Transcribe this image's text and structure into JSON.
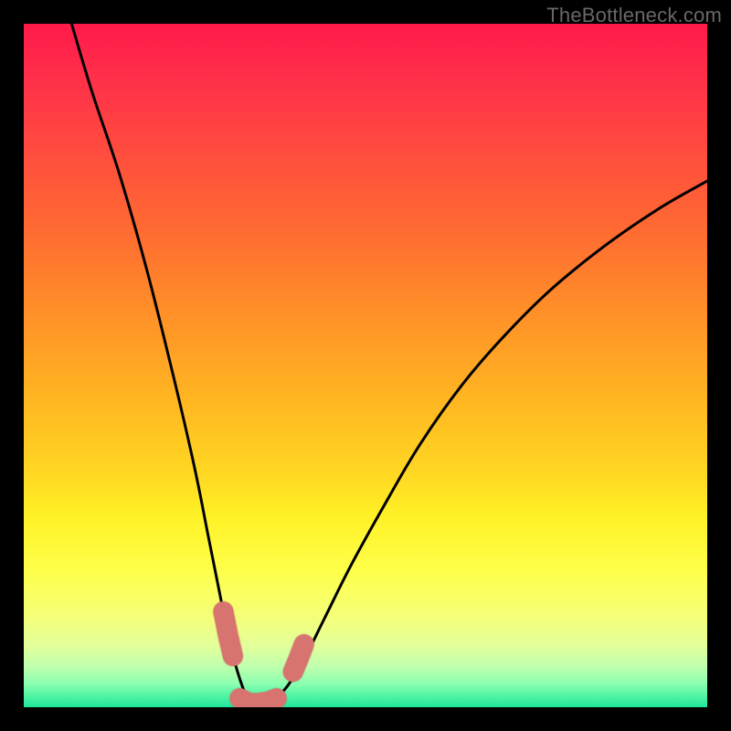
{
  "watermark": "TheBottleneck.com",
  "colors": {
    "frame": "#000000",
    "watermark": "#686868",
    "curve": "#000000",
    "markers_fill": "#d7746f",
    "markers_stroke": "#c8605b",
    "gradient_stops": [
      {
        "offset": 0.0,
        "color": "#ff1a4a"
      },
      {
        "offset": 0.08,
        "color": "#ff2f4a"
      },
      {
        "offset": 0.18,
        "color": "#ff4a3f"
      },
      {
        "offset": 0.3,
        "color": "#ff6a32"
      },
      {
        "offset": 0.42,
        "color": "#ff8f28"
      },
      {
        "offset": 0.55,
        "color": "#ffb621"
      },
      {
        "offset": 0.66,
        "color": "#ffd823"
      },
      {
        "offset": 0.72,
        "color": "#fff126"
      },
      {
        "offset": 0.8,
        "color": "#feff4a"
      },
      {
        "offset": 0.87,
        "color": "#f4ff7a"
      },
      {
        "offset": 0.91,
        "color": "#e2ff9a"
      },
      {
        "offset": 0.94,
        "color": "#c0ffad"
      },
      {
        "offset": 0.965,
        "color": "#8dffb0"
      },
      {
        "offset": 0.985,
        "color": "#4cf3a3"
      },
      {
        "offset": 1.0,
        "color": "#1fe59a"
      }
    ]
  },
  "chart_data": {
    "type": "line",
    "title": "",
    "xlabel": "",
    "ylabel": "",
    "xlim": [
      0,
      100
    ],
    "ylim": [
      0,
      100
    ],
    "series": [
      {
        "name": "bottleneck-curve",
        "x": [
          7,
          10,
          14,
          18,
          22,
          25,
          27,
          29,
          30.5,
          32,
          33,
          34,
          35,
          36.5,
          38.5,
          41,
          44,
          48,
          53,
          58,
          64,
          70,
          77,
          85,
          93,
          100
        ],
        "y": [
          100,
          90,
          78,
          64,
          48,
          35,
          25,
          15,
          8,
          3,
          1,
          0.5,
          0.5,
          1,
          3,
          7,
          13,
          21,
          30,
          38.5,
          47,
          54,
          61,
          67.5,
          73,
          77
        ]
      }
    ],
    "markers": {
      "name": "highlighted-segment",
      "segments": [
        {
          "x": [
            29.2,
            29.9,
            30.6
          ],
          "y": [
            14,
            10.5,
            7.5
          ]
        },
        {
          "x": [
            31.6,
            33.0,
            34.3,
            35.7,
            37.0
          ],
          "y": [
            1.3,
            0.6,
            0.6,
            0.8,
            1.3
          ]
        },
        {
          "x": [
            39.4,
            40.2,
            41.0
          ],
          "y": [
            5.2,
            7.1,
            9.2
          ]
        }
      ],
      "radius": 11
    }
  }
}
